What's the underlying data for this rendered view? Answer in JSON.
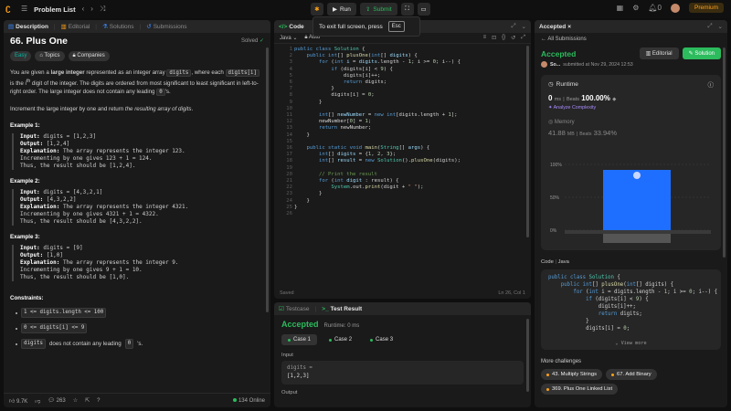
{
  "topbar": {
    "title": "Problem List",
    "run": "Run",
    "submit": "Submit",
    "premium": "Premium",
    "notif_count": "0"
  },
  "toast": {
    "text": "To exit full screen, press",
    "key": "Esc"
  },
  "desc_tabs": [
    "Description",
    "Editorial",
    "Solutions",
    "Submissions"
  ],
  "problem": {
    "title": "66. Plus One",
    "status": "Solved",
    "chips": [
      "Easy",
      "Topics",
      "Companies"
    ],
    "p1a": "You are given a ",
    "p1b": "large integer",
    "p1c": " represented as an integer array ",
    "p1d": "digits",
    "p1e": ", where each ",
    "p1f": "digits[i]",
    "p1g": " is the ",
    "p1h": "i",
    "p1i": "th",
    "p1j": " digit of the integer. The digits are ordered from most significant to least significant in left-to-right order. The large integer does not contain any leading ",
    "p1k": "0",
    "p1l": "'s.",
    "p2": "Increment the large integer by one and return ",
    "p2b": "the resulting array of digits",
    "p2c": ".",
    "examples": [
      {
        "h": "Example 1:",
        "in": "digits = [1,2,3]",
        "out": "[1,2,4]",
        "exp": "The array represents the integer 123.",
        "e2": "Incrementing by one gives 123 + 1 = 124.",
        "e3": "Thus, the result should be [1,2,4]."
      },
      {
        "h": "Example 2:",
        "in": "digits = [4,3,2,1]",
        "out": "[4,3,2,2]",
        "exp": "The array represents the integer 4321.",
        "e2": "Incrementing by one gives 4321 + 1 = 4322.",
        "e3": "Thus, the result should be [4,3,2,2]."
      },
      {
        "h": "Example 3:",
        "in": "digits = [9]",
        "out": "[1,0]",
        "exp": "The array represents the integer 9.",
        "e2": "Incrementing by one gives 9 + 1 = 10.",
        "e3": "Thus, the result should be [1,0]."
      }
    ],
    "labels": {
      "input": "Input:",
      "output": "Output:",
      "explanation": "Explanation:"
    },
    "constraints_h": "Constraints:",
    "c1": "1 <= digits.length <= 100",
    "c2": "0 <= digits[i] <= 9",
    "c3a": "digits",
    "c3b": " does not contain any leading ",
    "c3c": "0",
    "c3d": "'s."
  },
  "desc_foot": {
    "likes": "9.7K",
    "comments": "263",
    "online": "134 Online"
  },
  "code": {
    "title": "Code",
    "lang": "Java",
    "auto": "Auto",
    "saved": "Saved",
    "pos": "Ln 26, Col 1"
  },
  "test": {
    "tab1": "Testcase",
    "tab2": "Test Result",
    "status": "Accepted",
    "runtime": "Runtime: 0 ms",
    "cases": [
      "Case 1",
      "Case 2",
      "Case 3"
    ],
    "input_lbl": "Input",
    "var": "digits =",
    "val": "[1,2,3]",
    "output_lbl": "Output"
  },
  "acc": {
    "tab": "Accepted",
    "all": "All Submissions",
    "title": "Accepted",
    "editorial": "Editorial",
    "solution": "Solution",
    "user": "So...",
    "submitted": "submitted at Nov 29, 2024 12:53",
    "runtime_lbl": "Runtime",
    "rt_val": "0",
    "rt_unit": "ms",
    "beats": "Beats",
    "beats_val": "100.00%",
    "analyze": "Analyze Complexity",
    "memory_lbl": "Memory",
    "mem_val": "41.88",
    "mem_unit": "MB",
    "mem_beats": "Beats",
    "mem_beats_val": "33.94%",
    "code_lbl": "Code",
    "code_lang": "Java",
    "view_more": "View more",
    "more": "More challenges",
    "challenges": [
      "43. Multiply Strings",
      "67. Add Binary",
      "369. Plus One Linked List"
    ]
  },
  "chart_data": {
    "type": "bar",
    "y_ticks": [
      "100%",
      "50%",
      "0%"
    ],
    "ylim": [
      0,
      100
    ],
    "runtime_bar_height_pct": 100
  }
}
